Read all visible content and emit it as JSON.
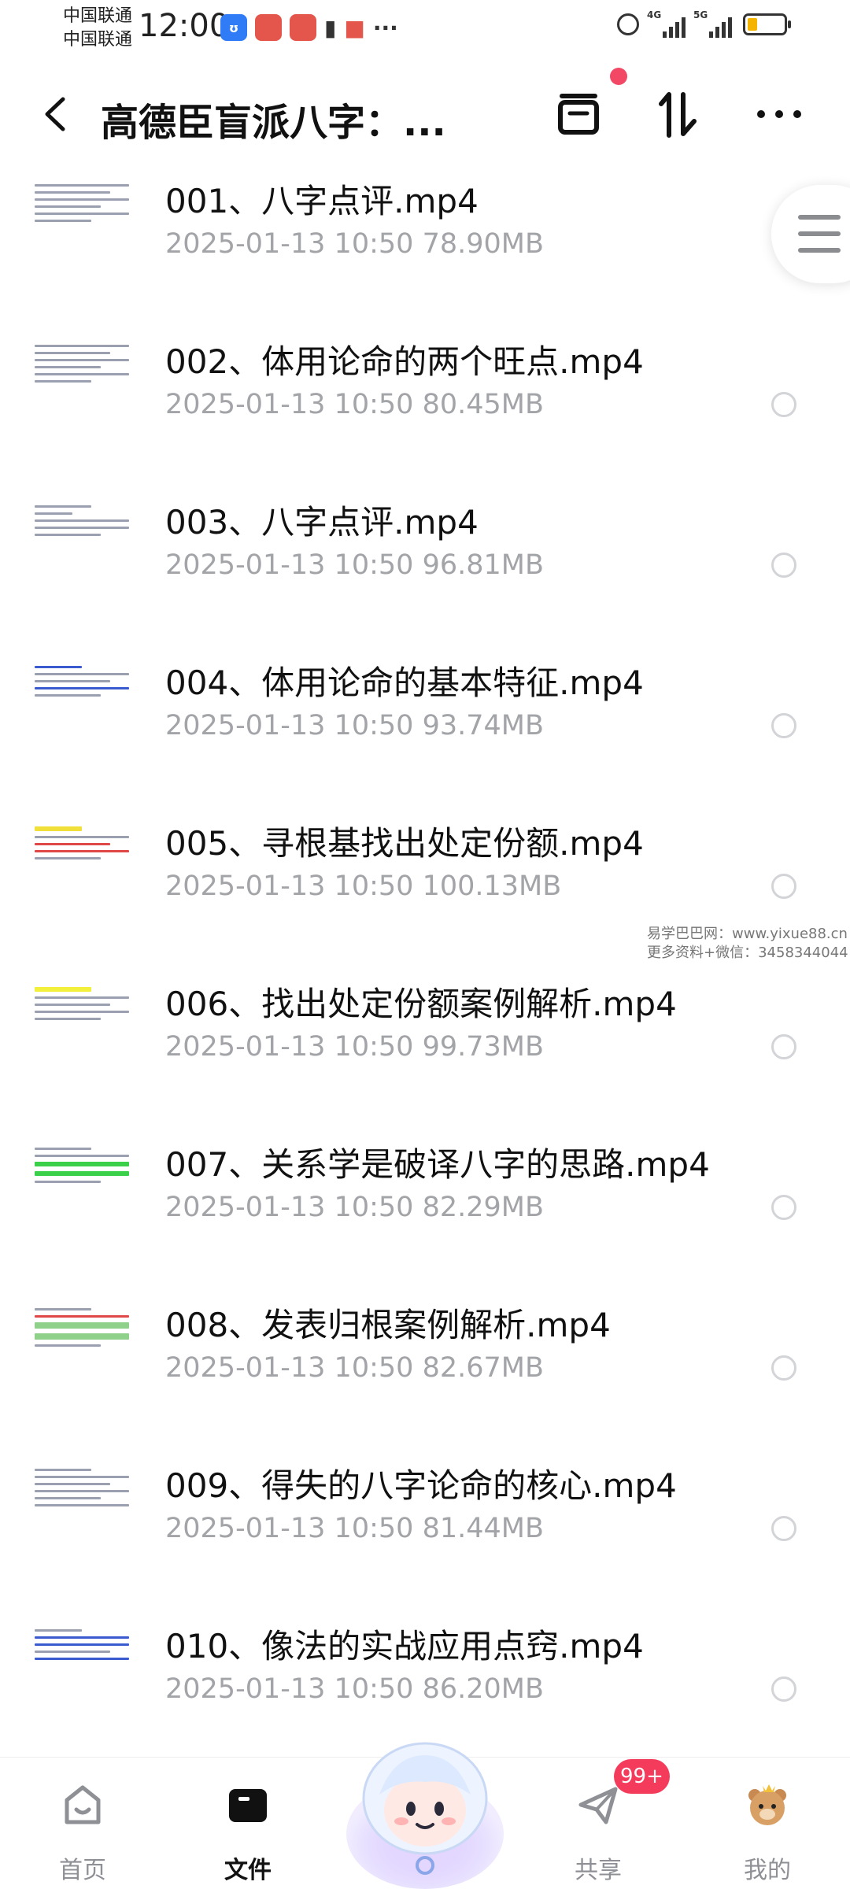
{
  "status_bar": {
    "carrier_1": "中国联通",
    "carrier_2": "中国联通",
    "time": "12:00",
    "net_1": "4G",
    "net_2": "5G"
  },
  "header": {
    "title": "高德臣盲派八字：..."
  },
  "files": [
    {
      "name": "001、八字点评.mp4",
      "date": "2025-01-13",
      "time": "10:50",
      "size": "78.90MB"
    },
    {
      "name": "002、体用论命的两个旺点.mp4",
      "date": "2025-01-13",
      "time": "10:50",
      "size": "80.45MB"
    },
    {
      "name": "003、八字点评.mp4",
      "date": "2025-01-13",
      "time": "10:50",
      "size": "96.81MB"
    },
    {
      "name": "004、体用论命的基本特征.mp4",
      "date": "2025-01-13",
      "time": "10:50",
      "size": "93.74MB"
    },
    {
      "name": "005、寻根基找出处定份额.mp4",
      "date": "2025-01-13",
      "time": "10:50",
      "size": "100.13MB"
    },
    {
      "name": "006、找出处定份额案例解析.mp4",
      "date": "2025-01-13",
      "time": "10:50",
      "size": "99.73MB"
    },
    {
      "name": "007、关系学是破译八字的思路.mp4",
      "date": "2025-01-13",
      "time": "10:50",
      "size": "82.29MB"
    },
    {
      "name": "008、发表归根案例解析.mp4",
      "date": "2025-01-13",
      "time": "10:50",
      "size": "82.67MB"
    },
    {
      "name": "009、得失的八字论命的核心.mp4",
      "date": "2025-01-13",
      "time": "10:50",
      "size": "81.44MB"
    },
    {
      "name": "010、像法的实战应用点窍.mp4",
      "date": "2025-01-13",
      "time": "10:50",
      "size": "86.20MB"
    }
  ],
  "watermark": {
    "line1": "易学巴巴网：www.yixue88.cn",
    "line2": "更多资料+微信：3458344044"
  },
  "bottom_nav": {
    "home": "首页",
    "files": "文件",
    "share": "共享",
    "mine": "我的",
    "share_badge": "99+"
  },
  "colors": {
    "accent_red": "#f24865",
    "badge_red": "#f53b5c",
    "meta_gray": "#a2a4a8"
  }
}
